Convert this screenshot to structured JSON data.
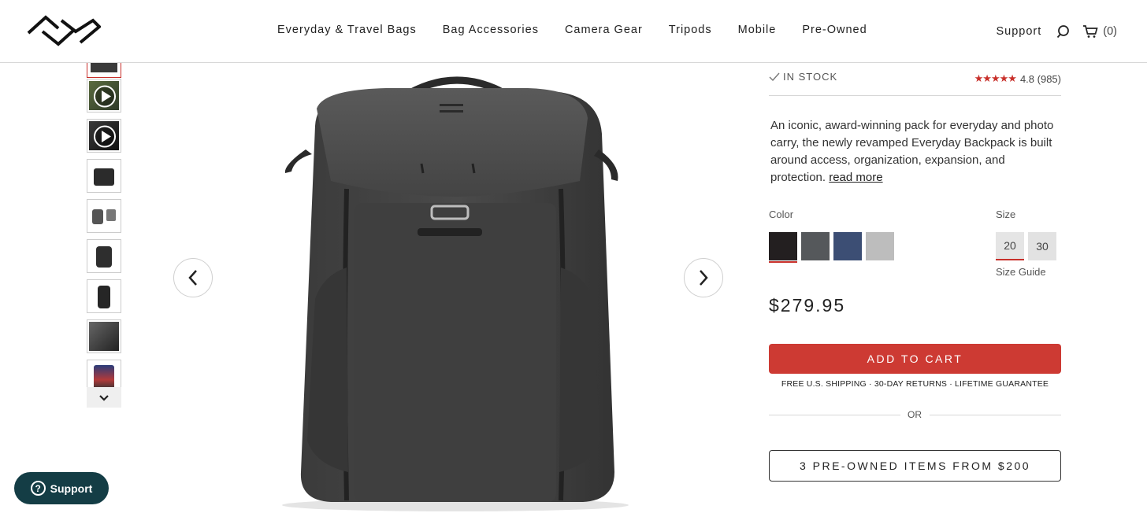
{
  "header": {
    "nav": [
      "Everyday & Travel Bags",
      "Bag Accessories",
      "Camera Gear",
      "Tripods",
      "Mobile",
      "Pre-Owned"
    ],
    "support_label": "Support",
    "cart_count": "(0)",
    "icons": [
      "logo-icon",
      "search-icon",
      "cart-icon"
    ]
  },
  "gallery": {
    "thumbnail_types": [
      "image",
      "video",
      "video",
      "image",
      "image",
      "image",
      "image",
      "image",
      "image"
    ],
    "icons": [
      "play-icon",
      "chevron-down-icon",
      "chevron-left-icon",
      "chevron-right-icon"
    ]
  },
  "product": {
    "stock": "IN STOCK",
    "rating_stars": "★★★★★",
    "rating_value": "4.8",
    "review_count": "(985)",
    "description": "An iconic, award-winning pack for everyday and photo carry, the newly revamped Everyday Backpack is built around access, organization, expansion, and protection.",
    "read_more": "read more",
    "color_label": "Color",
    "colors": [
      "#231f20",
      "#55585b",
      "#3c4e74",
      "#bdbdbd"
    ],
    "selected_color_index": 0,
    "size_label": "Size",
    "sizes": [
      "20",
      "30"
    ],
    "selected_size": "20",
    "size_guide": "Size Guide",
    "price": "$279.95",
    "add_to_cart": "ADD TO CART",
    "perks": "FREE U.S. SHIPPING · 30-DAY RETURNS · LIFETIME GUARANTEE",
    "or": "OR",
    "preowned": "3 PRE-OWNED ITEMS FROM $200"
  },
  "chat": {
    "label": "Support",
    "icon_glyph": "?"
  },
  "colors": {
    "accent": "#cd3a33",
    "chat_bg": "#143d45"
  }
}
